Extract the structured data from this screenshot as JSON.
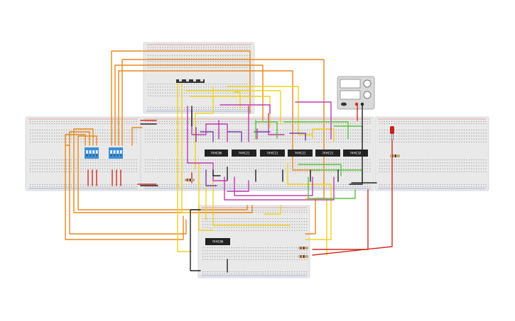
{
  "canvas": {
    "background": "#ffffff"
  },
  "colors": {
    "breadboard": "#e9e9e9",
    "breadboard_edge": "#d2d2d2",
    "hole": "#9a9a9a",
    "rail_red": "#d33a2c",
    "rail_blue": "#3a63c8",
    "chip": "#222222",
    "dip_switch": "#3d8fd6",
    "wire_orange": "#e8891c",
    "wire_yellow": "#f0d21e",
    "wire_magenta": "#c23bb0",
    "wire_purple": "#7b3fb5",
    "wire_green": "#5cc43b",
    "wire_red": "#d32a1f",
    "wire_black": "#222222",
    "wire_gray": "#888888",
    "resistor": "#c9a27a",
    "led": "#c8201a",
    "power_supply": "#d9d9d9"
  },
  "chips": [
    {
      "id": "chip-1",
      "label": "74HC86"
    },
    {
      "id": "chip-2",
      "label": "74HC21"
    },
    {
      "id": "chip-3",
      "label": "74HC21"
    },
    {
      "id": "chip-4",
      "label": "74HC21"
    },
    {
      "id": "chip-5",
      "label": "74HC21"
    },
    {
      "id": "chip-6",
      "label": "74HC32"
    },
    {
      "id": "chip-7",
      "label": "74HC86"
    }
  ],
  "components": {
    "dip_switches": 2,
    "breadboards": 5,
    "power_supply": "bench power supply",
    "led": "red LED",
    "resistors": 4
  }
}
